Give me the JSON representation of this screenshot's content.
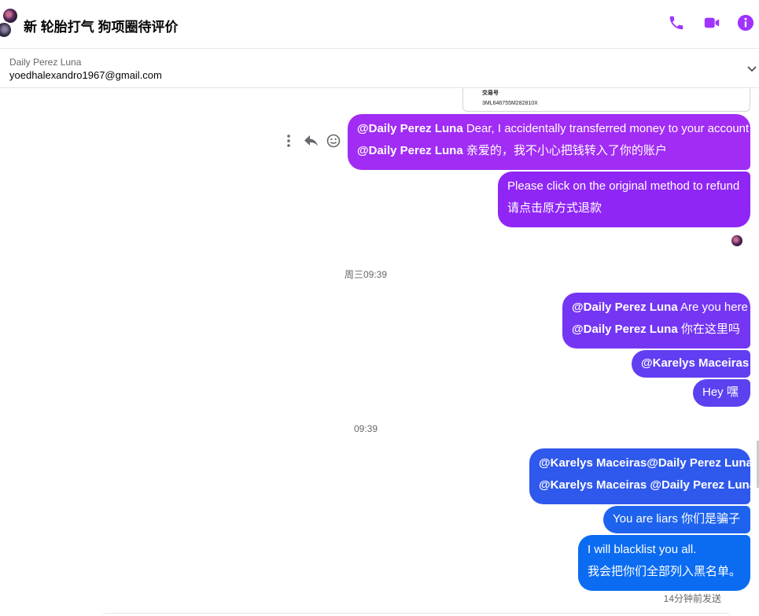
{
  "header": {
    "title": "新 轮胎打气 狗项圈待评价",
    "icons": [
      "phone-icon",
      "video-camera-icon",
      "info-icon"
    ],
    "accent_color": "#a033ff"
  },
  "banner": {
    "name": "Daily Perez Luna",
    "email": "yoedhalexandro1967@gmail.com"
  },
  "receipt": {
    "label": "交易号",
    "value": "3ML646755M282810X"
  },
  "message_actions": [
    "more-options-icon",
    "reply-icon",
    "emoji-reaction-icon"
  ],
  "messages": {
    "m1": {
      "l1_mention": "@Daily Perez Luna",
      "l1_text": " Dear, I accidentally transferred money to your account",
      "l2_mention": "@Daily Perez Luna",
      "l2_text": " 亲爱的，我不小心把钱转入了你的账户"
    },
    "m2": {
      "l1": "Please click on the original method to refund",
      "l2": "请点击原方式退款"
    },
    "t1": "周三09:39",
    "m3": {
      "l1_mention": "@Daily Perez Luna",
      "l1_text": " Are you here",
      "l2_mention": "@Daily Perez Luna",
      "l2_text": " 你在这里吗"
    },
    "m4": {
      "mention": "@Karelys Maceiras"
    },
    "m5": {
      "text": "Hey  嘿"
    },
    "t2": "09:39",
    "m6": {
      "l1": "@Karelys Maceiras@Daily Perez Luna",
      "l2": "@Karelys Maceiras @Daily Perez Luna"
    },
    "m7": {
      "text": "You are liars  你们是骗子"
    },
    "m8": {
      "l1": "I will blacklist you all.",
      "l2": "我会把你们全部列入黑名单。"
    }
  },
  "status": {
    "sent": "14分钟前发送"
  }
}
